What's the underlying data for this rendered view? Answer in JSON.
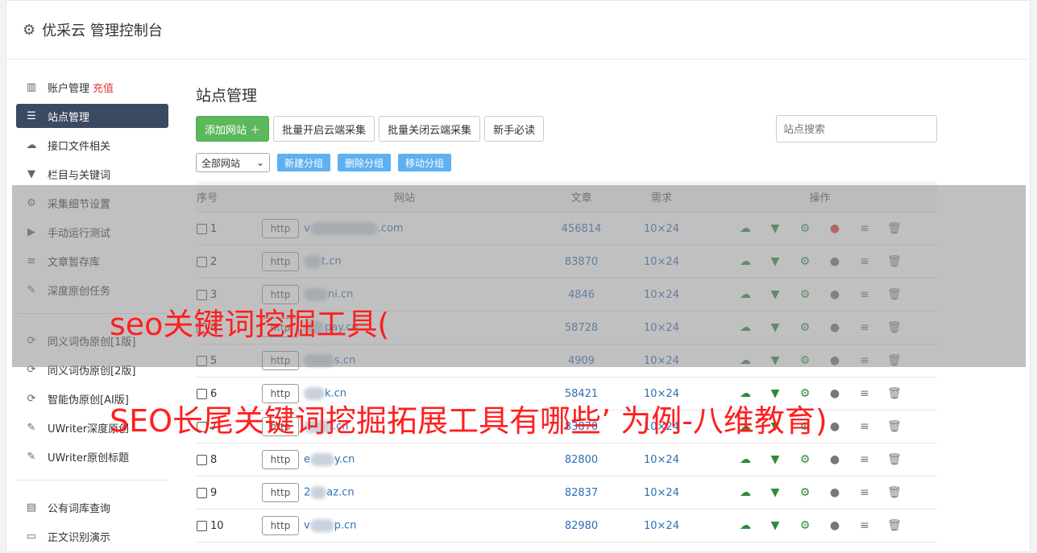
{
  "header": {
    "title": "优采云 管理控制台"
  },
  "sidebar": {
    "items": [
      {
        "label": "账户管理",
        "extra": "充值",
        "icon": "bar-chart-icon",
        "glyph": "▥",
        "active": false
      },
      {
        "label": "站点管理",
        "icon": "server-icon",
        "glyph": "☰",
        "active": true
      },
      {
        "label": "接口文件相关",
        "icon": "cloud-upload-icon",
        "glyph": "☁",
        "active": false
      },
      {
        "label": "栏目与关键词",
        "icon": "filter-icon",
        "glyph": "▼",
        "active": false
      },
      {
        "label": "采集细节设置",
        "icon": "cogs-icon",
        "glyph": "⚙",
        "active": false
      },
      {
        "label": "手动运行测试",
        "icon": "play-icon",
        "glyph": "▶",
        "active": false
      },
      {
        "label": "文章暂存库",
        "icon": "database-icon",
        "glyph": "≡",
        "active": false
      },
      {
        "label": "深度原创任务",
        "icon": "edit-icon",
        "glyph": "✎",
        "active": false
      }
    ],
    "items2": [
      {
        "label": "同义词伪原创[1版]",
        "icon": "refresh-icon",
        "glyph": "⟳"
      },
      {
        "label": "同义词伪原创[2版]",
        "icon": "refresh-icon",
        "glyph": "⟳"
      },
      {
        "label": "智能伪原创[AI版]",
        "icon": "refresh-icon",
        "glyph": "⟳"
      },
      {
        "label": "UWriter深度原创",
        "icon": "edit-icon",
        "glyph": "✎"
      },
      {
        "label": "UWriter原创标题",
        "icon": "edit-icon",
        "glyph": "✎"
      }
    ],
    "items3": [
      {
        "label": "公有词库查询",
        "icon": "book-icon",
        "glyph": "▤"
      },
      {
        "label": "正文识别演示",
        "icon": "monitor-icon",
        "glyph": "▭"
      }
    ]
  },
  "main": {
    "title": "站点管理",
    "buttons": {
      "add": "添加网站 ＋",
      "enable": "批量开启云端采集",
      "disable": "批量关闭云端采集",
      "guide": "新手必读"
    },
    "search_placeholder": "站点搜索",
    "group_select": "全部网站",
    "group_buttons": {
      "new": "新建分组",
      "delete": "删除分组",
      "move": "移动分组"
    },
    "table": {
      "headers": [
        "序号",
        "网站",
        "文章",
        "需求",
        "操作"
      ],
      "rows": [
        {
          "no": "1",
          "http": "http",
          "prefix": "v",
          "suffix": ".com",
          "articles": "456814",
          "demand": "10×24",
          "running": true
        },
        {
          "no": "2",
          "http": "http",
          "prefix": "",
          "suffix": "t.cn",
          "articles": "83870",
          "demand": "10×24",
          "running": false
        },
        {
          "no": "3",
          "http": "http",
          "prefix": "",
          "suffix": "ni.cn",
          "articles": "4846",
          "demand": "10×24",
          "running": false
        },
        {
          "no": "4",
          "http": "http",
          "prefix": "",
          "suffix": "pay.cn",
          "articles": "58728",
          "demand": "10×24",
          "running": false
        },
        {
          "no": "5",
          "http": "http",
          "prefix": "",
          "suffix": "s.cn",
          "articles": "4909",
          "demand": "10×24",
          "running": false
        },
        {
          "no": "6",
          "http": "http",
          "prefix": "",
          "suffix": "k.cn",
          "articles": "58421",
          "demand": "10×24",
          "running": false
        },
        {
          "no": "7",
          "http": "http",
          "prefix": "",
          "suffix": ".cn",
          "articles": "83870",
          "demand": "10×24",
          "running": false
        },
        {
          "no": "8",
          "http": "http",
          "prefix": "e",
          "suffix": "y.cn",
          "articles": "82800",
          "demand": "10×24",
          "running": false
        },
        {
          "no": "9",
          "http": "http",
          "prefix": "2",
          "suffix": "az.cn",
          "articles": "82837",
          "demand": "10×24",
          "running": false
        },
        {
          "no": "10",
          "http": "http",
          "prefix": "v",
          "suffix": "p.cn",
          "articles": "82980",
          "demand": "10×24",
          "running": false
        }
      ]
    }
  },
  "overlay": {
    "line1": "seo关键词挖掘工具(",
    "line2": "SEO长尾关键词挖掘拓展工具有哪些’ 为例-八维教育)"
  }
}
